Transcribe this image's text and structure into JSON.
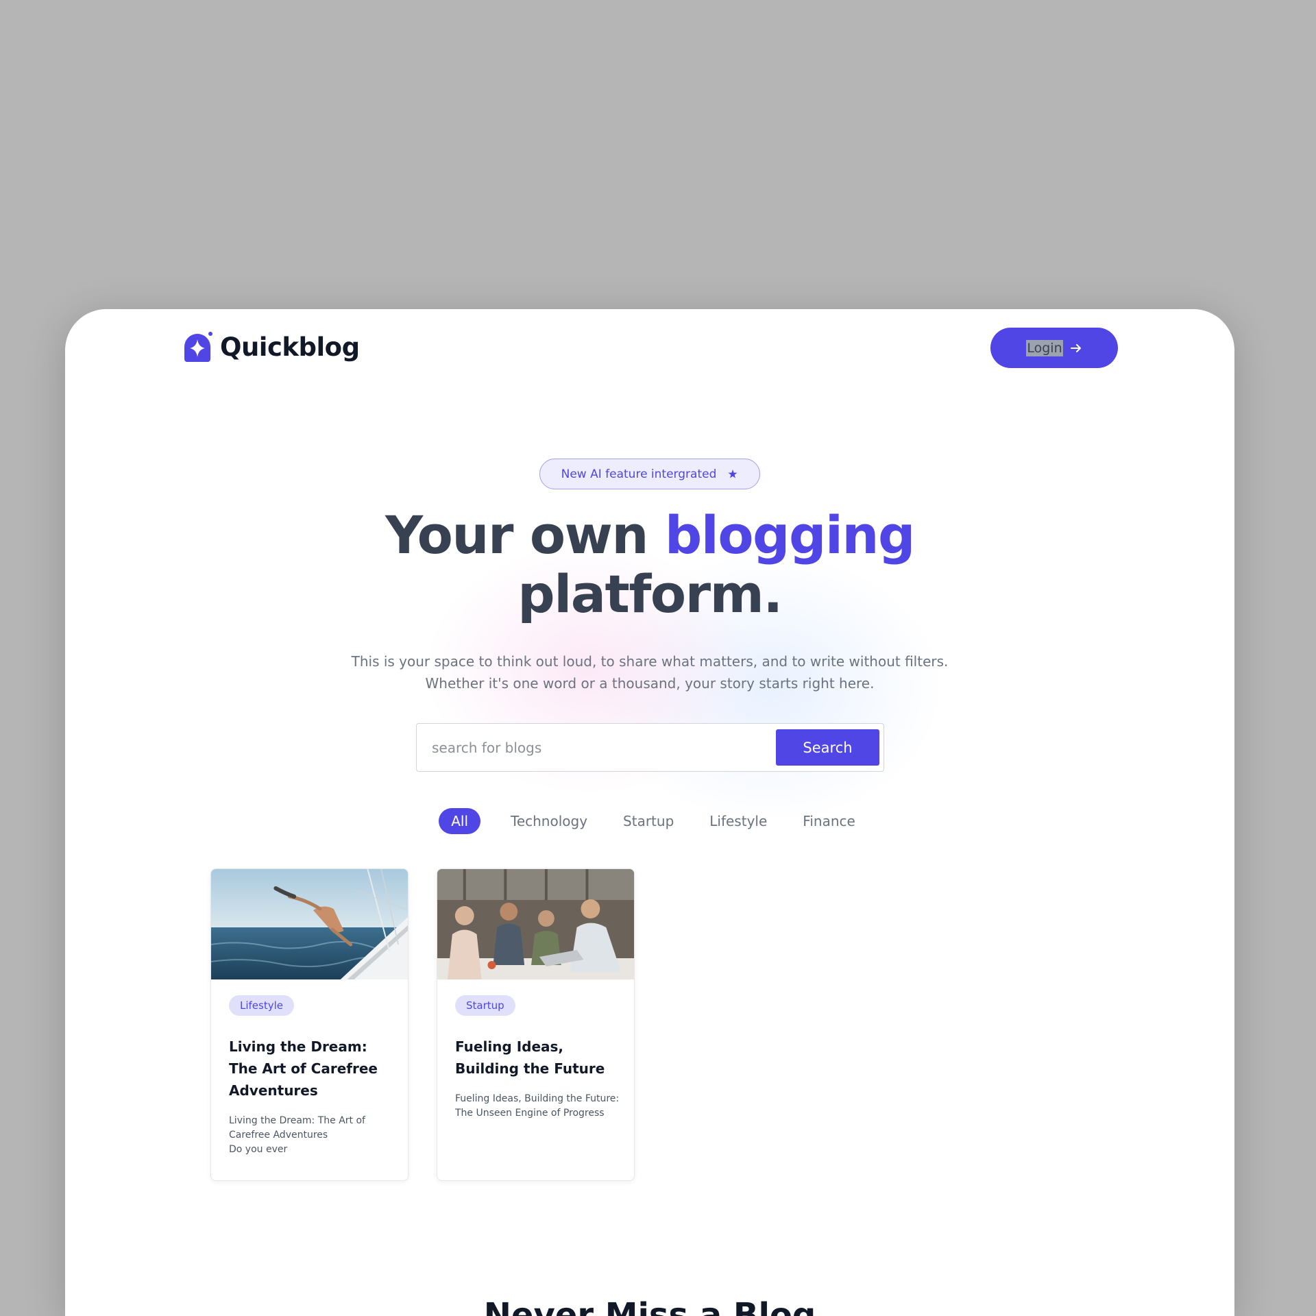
{
  "brand": {
    "name": "Quickblog",
    "accent": "#4f46e5"
  },
  "header": {
    "login_label": "Login"
  },
  "hero": {
    "badge": "New AI feature intergrated",
    "title_part1": "Your own ",
    "title_accent": "blogging",
    "title_part2": "platform.",
    "subtitle": "This is your space to think out loud, to share what matters, and to write without filters. Whether it's one word or a thousand, your story starts right here."
  },
  "search": {
    "placeholder": "search for blogs",
    "button_label": "Search"
  },
  "filters": [
    "All",
    "Technology",
    "Startup",
    "Lifestyle",
    "Finance"
  ],
  "active_filter": "All",
  "cards": [
    {
      "tag": "Lifestyle",
      "title": "Living the Dream: The Art of Carefree Adventures",
      "description": "Living the Dream: The Art of Carefree Adventures\nDo you ever",
      "image": "sailing-photo"
    },
    {
      "tag": "Startup",
      "title": "Fueling Ideas, Building the Future",
      "description": "Fueling Ideas, Building the Future: The Unseen Engine of Progress",
      "image": "team-meeting-photo"
    }
  ],
  "section_title": "Never Miss a Blog"
}
